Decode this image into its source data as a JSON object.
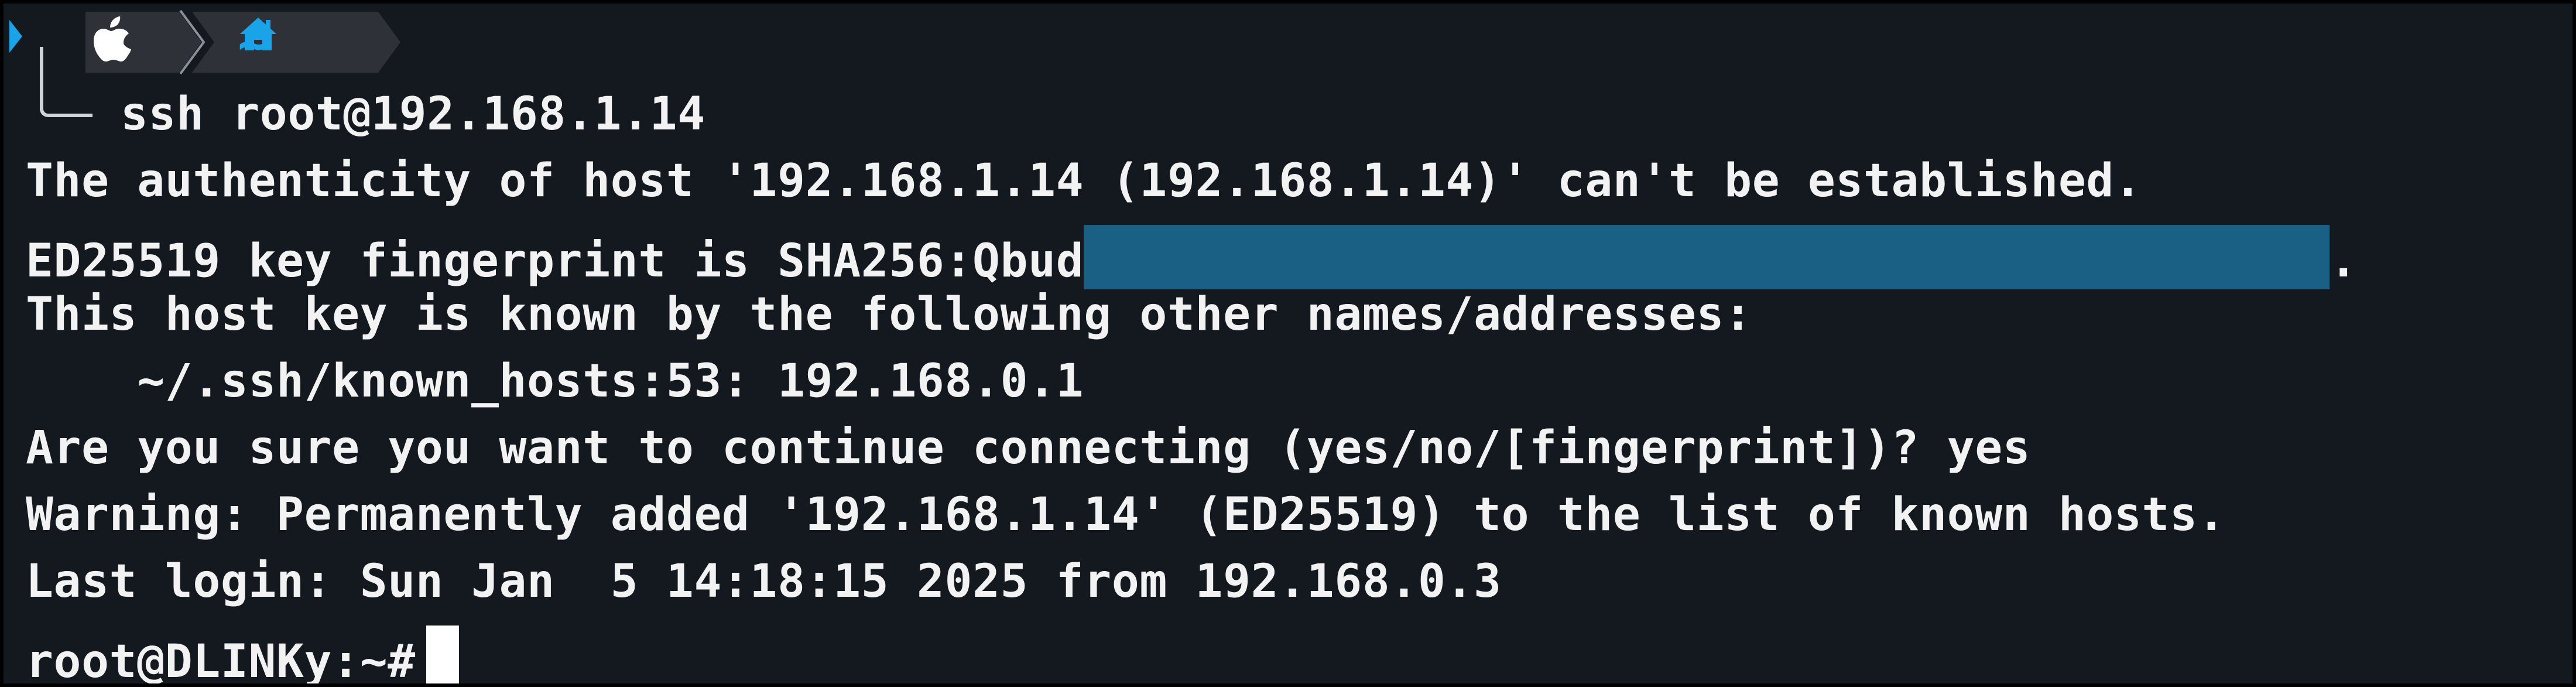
{
  "prompt": {
    "os_icon": "apple-icon",
    "home_icon": "home-icon",
    "path": "~",
    "command": "ssh root@192.168.1.14"
  },
  "output": {
    "authenticity": "The authenticity of host '192.168.1.14 (192.168.1.14)' can't be established.",
    "fingerprint_prefix": "ED25519 key fingerprint is SHA256:Qbud",
    "fingerprint_suffix": ".",
    "known_by": "This host key is known by the following other names/addresses:",
    "known_hosts_entry": "    ~/.ssh/known_hosts:53: 192.168.0.1",
    "confirm": "Are you sure you want to continue connecting (yes/no/[fingerprint])? yes",
    "warning": "Warning: Permanently added '192.168.1.14' (ED25519) to the list of known hosts.",
    "last_login": "Last login: Sun Jan  5 14:18:15 2025 from 192.168.0.3",
    "new_prompt": "root@DLINKy:~#"
  },
  "colors": {
    "background": "#141920",
    "segment": "#2e3238",
    "accent": "#1aa3e8",
    "redaction": "#1a5f84",
    "text": "#f2f2f2"
  }
}
